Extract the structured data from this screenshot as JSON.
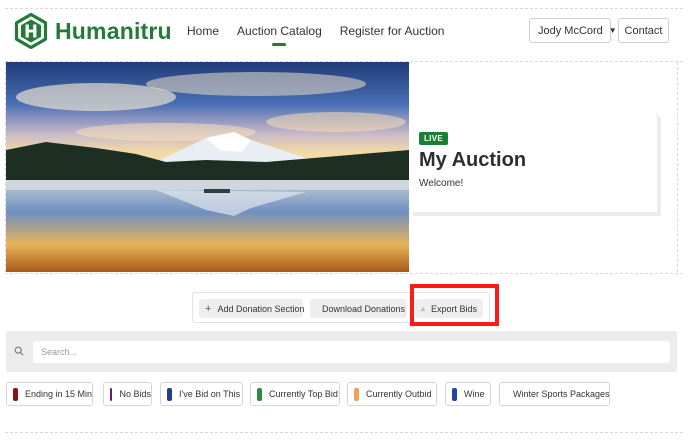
{
  "header": {
    "brand": "Humanitru",
    "brand_color": "#237a3a",
    "logo_icon": "hexagon-h-logo",
    "nav": [
      {
        "label": "Home",
        "active": false
      },
      {
        "label": "Auction Catalog",
        "active": true
      },
      {
        "label": "Register for Auction",
        "active": false
      }
    ],
    "user_menu": {
      "label": "Jody McCord",
      "icon": "caret-down-icon"
    },
    "contact_label": "Contact"
  },
  "hero": {
    "image_alt": "mountain-lake-landscape",
    "status_badge": "LIVE",
    "badge_color": "#1e7e34",
    "title": "My Auction",
    "subtitle": "Welcome!"
  },
  "toolbar": {
    "add_section_label": "Add Donation Section",
    "add_section_icon": "plus-icon",
    "download_label": "Download Donations",
    "download_icon": "download-icon",
    "export_label": "Export Bids",
    "export_icon": "download-icon",
    "highlight_color": "#ff1a1a"
  },
  "search": {
    "placeholder": "Search...",
    "value": "",
    "icon": "search-icon"
  },
  "filters": [
    {
      "label": "Ending in 15 Min",
      "color": "#8b1212"
    },
    {
      "label": "No Bids",
      "color": "#6a1b6e"
    },
    {
      "label": "I've Bid on This",
      "color": "#213f8f"
    },
    {
      "label": "Currently Top Bid",
      "color": "#2e8b3d"
    },
    {
      "label": "Currently Outbid",
      "color": "#f0a05a"
    },
    {
      "label": "Wine",
      "color": "#2442a8"
    },
    {
      "label": "Winter Sports Packages",
      "color": "#f2c46e"
    }
  ]
}
